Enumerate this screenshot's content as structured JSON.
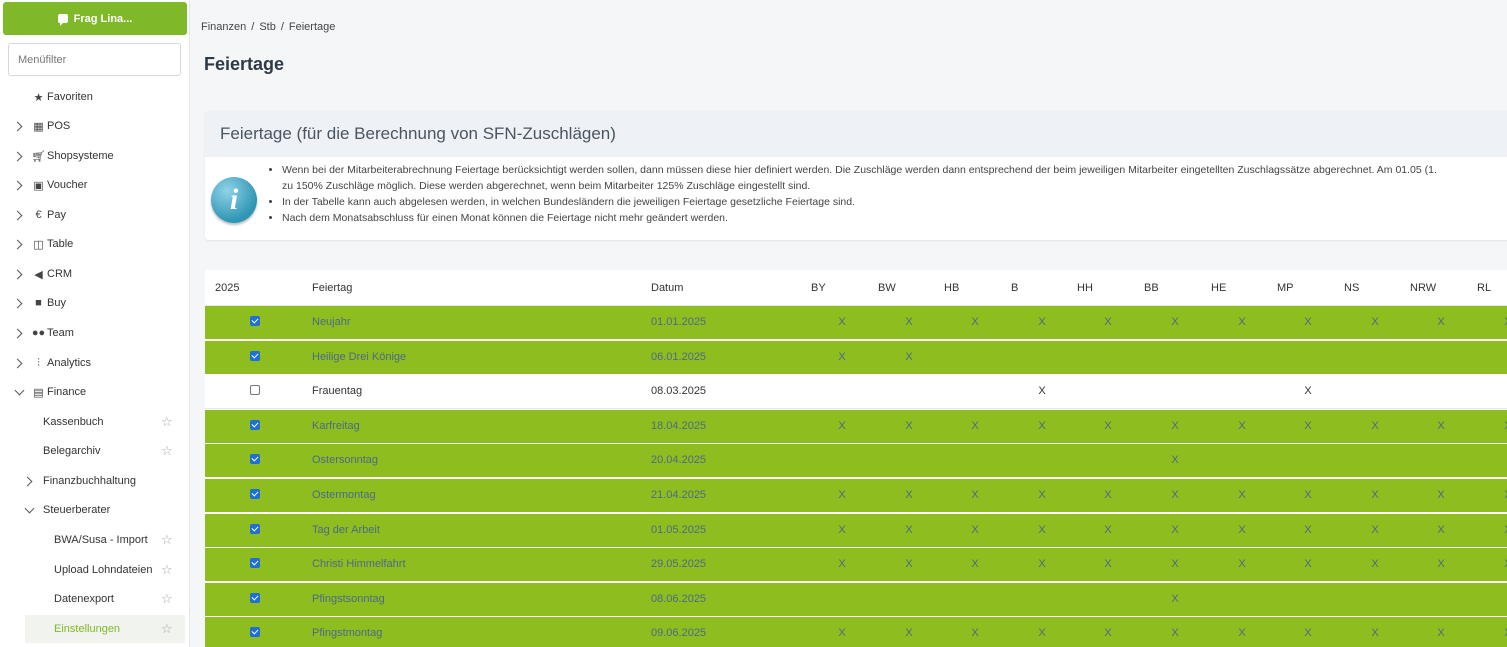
{
  "sidebar": {
    "ask_label": "Frag Lina...",
    "filter_placeholder": "Menüfilter",
    "items": [
      {
        "label": "Favoriten",
        "icon": "star-icon"
      },
      {
        "label": "POS",
        "icon": "pos-icon"
      },
      {
        "label": "Shopsysteme",
        "icon": "cart-icon"
      },
      {
        "label": "Voucher",
        "icon": "gift-icon"
      },
      {
        "label": "Pay",
        "icon": "euro-icon"
      },
      {
        "label": "Table",
        "icon": "book-icon"
      },
      {
        "label": "CRM",
        "icon": "megaphone-icon"
      },
      {
        "label": "Buy",
        "icon": "truck-icon"
      },
      {
        "label": "Team",
        "icon": "users-icon"
      },
      {
        "label": "Analytics",
        "icon": "analytics-icon"
      },
      {
        "label": "Finance",
        "icon": "calculator-icon"
      },
      {
        "label": "Kassenbuch"
      },
      {
        "label": "Belegarchiv"
      },
      {
        "label": "Finanzbuchhaltung"
      },
      {
        "label": "Steuerberater"
      },
      {
        "label": "BWA/Susa - Import"
      },
      {
        "label": "Upload Lohndateien"
      },
      {
        "label": "Datenexport"
      },
      {
        "label": "Einstellungen"
      }
    ]
  },
  "breadcrumb": [
    "Finanzen",
    "Stb",
    "Feiertage"
  ],
  "page_title": "Feiertage",
  "info": {
    "title": "Feiertage (für die Berechnung von SFN-Zuschlägen)",
    "line1": "Wenn bei der Mitarbeiterabrechnung Feiertage berücksichtigt werden sollen, dann müssen diese hier definiert werden. Die Zuschläge werden dann entsprechend der beim jeweiligen Mitarbeiter eingetellten Zuschlagssätze abgerechnet. Am 01.05 (1.",
    "line1b": "zu 150% Zuschläge möglich. Diese werden abgerechnet, wenn beim Mitarbeiter 125% Zuschläge eingestellt sind.",
    "line2": "In der Tabelle kann auch abgelesen werden, in welchen Bundesländern die jeweiligen Feiertage gesetzliche Feiertage sind.",
    "line3": "Nach dem Monatsabschluss für einen Monat können die Feiertage nicht mehr geändert werden."
  },
  "table": {
    "headers": {
      "year": "2025",
      "holiday": "Feiertag",
      "date": "Datum"
    },
    "states": [
      "BY",
      "BW",
      "HB",
      "B",
      "HH",
      "BB",
      "HE",
      "MP",
      "NS",
      "NRW",
      "RL"
    ],
    "rows": [
      {
        "checked": true,
        "name": "Neujahr",
        "date": "01.01.2025",
        "marks": [
          "X",
          "X",
          "X",
          "X",
          "X",
          "X",
          "X",
          "X",
          "X",
          "X",
          "X"
        ]
      },
      {
        "checked": true,
        "name": "Heilige Drei Könige",
        "date": "06.01.2025",
        "marks": [
          "X",
          "X",
          "",
          "",
          "",
          "",
          "",
          "",
          "",
          "",
          ""
        ]
      },
      {
        "checked": false,
        "name": "Frauentag",
        "date": "08.03.2025",
        "marks": [
          "",
          "",
          "",
          "X",
          "",
          "",
          "",
          "X",
          "",
          "",
          ""
        ]
      },
      {
        "checked": true,
        "name": "Karfreitag",
        "date": "18.04.2025",
        "marks": [
          "X",
          "X",
          "X",
          "X",
          "X",
          "X",
          "X",
          "X",
          "X",
          "X",
          "X"
        ]
      },
      {
        "checked": true,
        "name": "Ostersonntag",
        "date": "20.04.2025",
        "marks": [
          "",
          "",
          "",
          "",
          "",
          "X",
          "",
          "",
          "",
          "",
          ""
        ]
      },
      {
        "checked": true,
        "name": "Ostermontag",
        "date": "21.04.2025",
        "marks": [
          "X",
          "X",
          "X",
          "X",
          "X",
          "X",
          "X",
          "X",
          "X",
          "X",
          "X"
        ]
      },
      {
        "checked": true,
        "name": "Tag der Arbeit",
        "date": "01.05.2025",
        "marks": [
          "X",
          "X",
          "X",
          "X",
          "X",
          "X",
          "X",
          "X",
          "X",
          "X",
          "X"
        ]
      },
      {
        "checked": true,
        "name": "Christi Himmelfahrt",
        "date": "29.05.2025",
        "marks": [
          "X",
          "X",
          "X",
          "X",
          "X",
          "X",
          "X",
          "X",
          "X",
          "X",
          "X"
        ]
      },
      {
        "checked": true,
        "name": "Pfingstsonntag",
        "date": "08.06.2025",
        "marks": [
          "",
          "",
          "",
          "",
          "",
          "X",
          "",
          "",
          "",
          "",
          ""
        ]
      },
      {
        "checked": true,
        "name": "Pfingstmontag",
        "date": "09.06.2025",
        "marks": [
          "X",
          "X",
          "X",
          "X",
          "X",
          "X",
          "X",
          "X",
          "X",
          "X",
          "X"
        ]
      }
    ]
  },
  "colors": {
    "accent": "#7fb92a",
    "row_active": "#8dbd1f",
    "checkbox": "#1e6fd9"
  }
}
